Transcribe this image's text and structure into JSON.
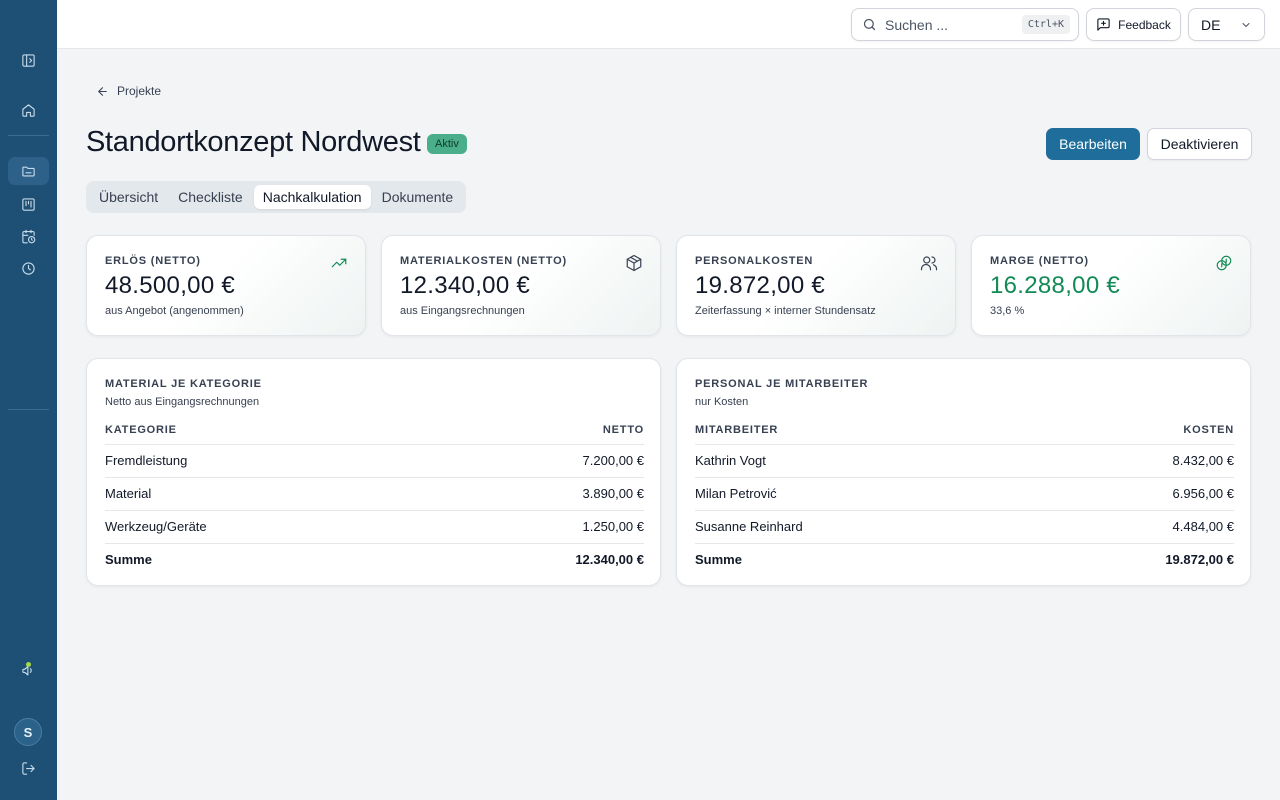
{
  "topbar": {
    "search_placeholder": "Suchen ...",
    "search_shortcut": "Ctrl+K",
    "feedback_label": "Feedback",
    "language": "DE"
  },
  "sidebar": {
    "user_initial": "S"
  },
  "breadcrumb": {
    "label": "Projekte"
  },
  "project": {
    "title": "Standortkonzept Nordwest",
    "status": "Aktiv",
    "edit_label": "Bearbeiten",
    "deactivate_label": "Deaktivieren"
  },
  "tabs": [
    {
      "label": "Übersicht",
      "active": false
    },
    {
      "label": "Checkliste",
      "active": false
    },
    {
      "label": "Nachkalkulation",
      "active": true
    },
    {
      "label": "Dokumente",
      "active": false
    }
  ],
  "kpis": [
    {
      "label": "ERLÖS (NETTO)",
      "value": "48.500,00 €",
      "sub": "aus Angebot (angenommen)",
      "icon": "trending-up-icon"
    },
    {
      "label": "MATERIALKOSTEN (NETTO)",
      "value": "12.340,00 €",
      "sub": "aus Eingangsrechnungen",
      "icon": "package-icon"
    },
    {
      "label": "PERSONALKOSTEN",
      "value": "19.872,00 €",
      "sub": "Zeiterfassung × interner Stundensatz",
      "icon": "users-icon"
    },
    {
      "label": "MARGE (NETTO)",
      "value": "16.288,00 €",
      "sub": "33,6 %",
      "icon": "coins-icon"
    }
  ],
  "colors": {
    "sidebar": "#1e4f74",
    "primary": "#1e6d9b",
    "margin_green": "#118a55",
    "badge": "#4aae8a"
  },
  "material_table": {
    "title": "MATERIAL JE KATEGORIE",
    "subtitle": "Netto aus Eingangsrechnungen",
    "columns": [
      "KATEGORIE",
      "NETTO"
    ],
    "rows": [
      [
        "Fremdleistung",
        "7.200,00 €"
      ],
      [
        "Material",
        "3.890,00 €"
      ],
      [
        "Werkzeug/Geräte",
        "1.250,00 €"
      ]
    ],
    "sum": [
      "Summe",
      "12.340,00 €"
    ]
  },
  "staff_table": {
    "title": "PERSONAL JE MITARBEITER",
    "subtitle": "nur Kosten",
    "columns": [
      "MITARBEITER",
      "KOSTEN"
    ],
    "rows": [
      [
        "Kathrin Vogt",
        "8.432,00 €"
      ],
      [
        "Milan Petrović",
        "6.956,00 €"
      ],
      [
        "Susanne Reinhard",
        "4.484,00 €"
      ]
    ],
    "sum": [
      "Summe",
      "19.872,00 €"
    ]
  }
}
